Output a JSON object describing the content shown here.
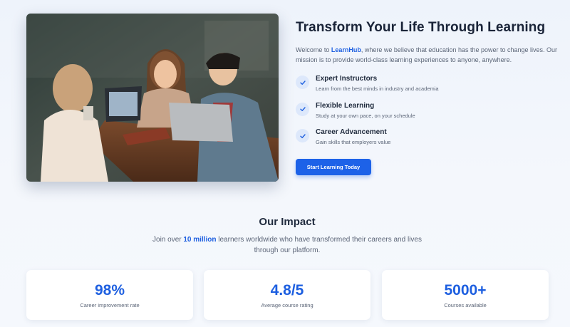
{
  "hero": {
    "title": "Transform Your Life Through Learning",
    "desc_prefix": "Welcome to ",
    "brand": "LearnHub",
    "desc_suffix": ", where we believe that education has the power to change lives. Our mission is to provide world-class learning experiences to anyone, anywhere.",
    "image_icon": "students-photo",
    "features": [
      {
        "icon": "check-icon",
        "title": "Expert Instructors",
        "desc": "Learn from the best minds in industry and academia"
      },
      {
        "icon": "check-icon",
        "title": "Flexible Learning",
        "desc": "Study at your own pace, on your schedule"
      },
      {
        "icon": "check-icon",
        "title": "Career Advancement",
        "desc": "Gain skills that employers value"
      }
    ],
    "cta_label": "Start Learning Today"
  },
  "impact": {
    "title": "Our Impact",
    "desc_prefix": "Join over ",
    "highlight": "10 million",
    "desc_suffix": " learners worldwide who have transformed their careers and lives through our platform.",
    "stats": [
      {
        "value": "98%",
        "label": "Career improvement rate"
      },
      {
        "value": "4.8/5",
        "label": "Average course rating"
      },
      {
        "value": "5000+",
        "label": "Courses available"
      }
    ]
  },
  "colors": {
    "accent": "#1d5fe0",
    "button": "#1d62e8",
    "check_bg": "#dde8fb",
    "text": "#1f2a3d",
    "muted": "#5b6577"
  }
}
